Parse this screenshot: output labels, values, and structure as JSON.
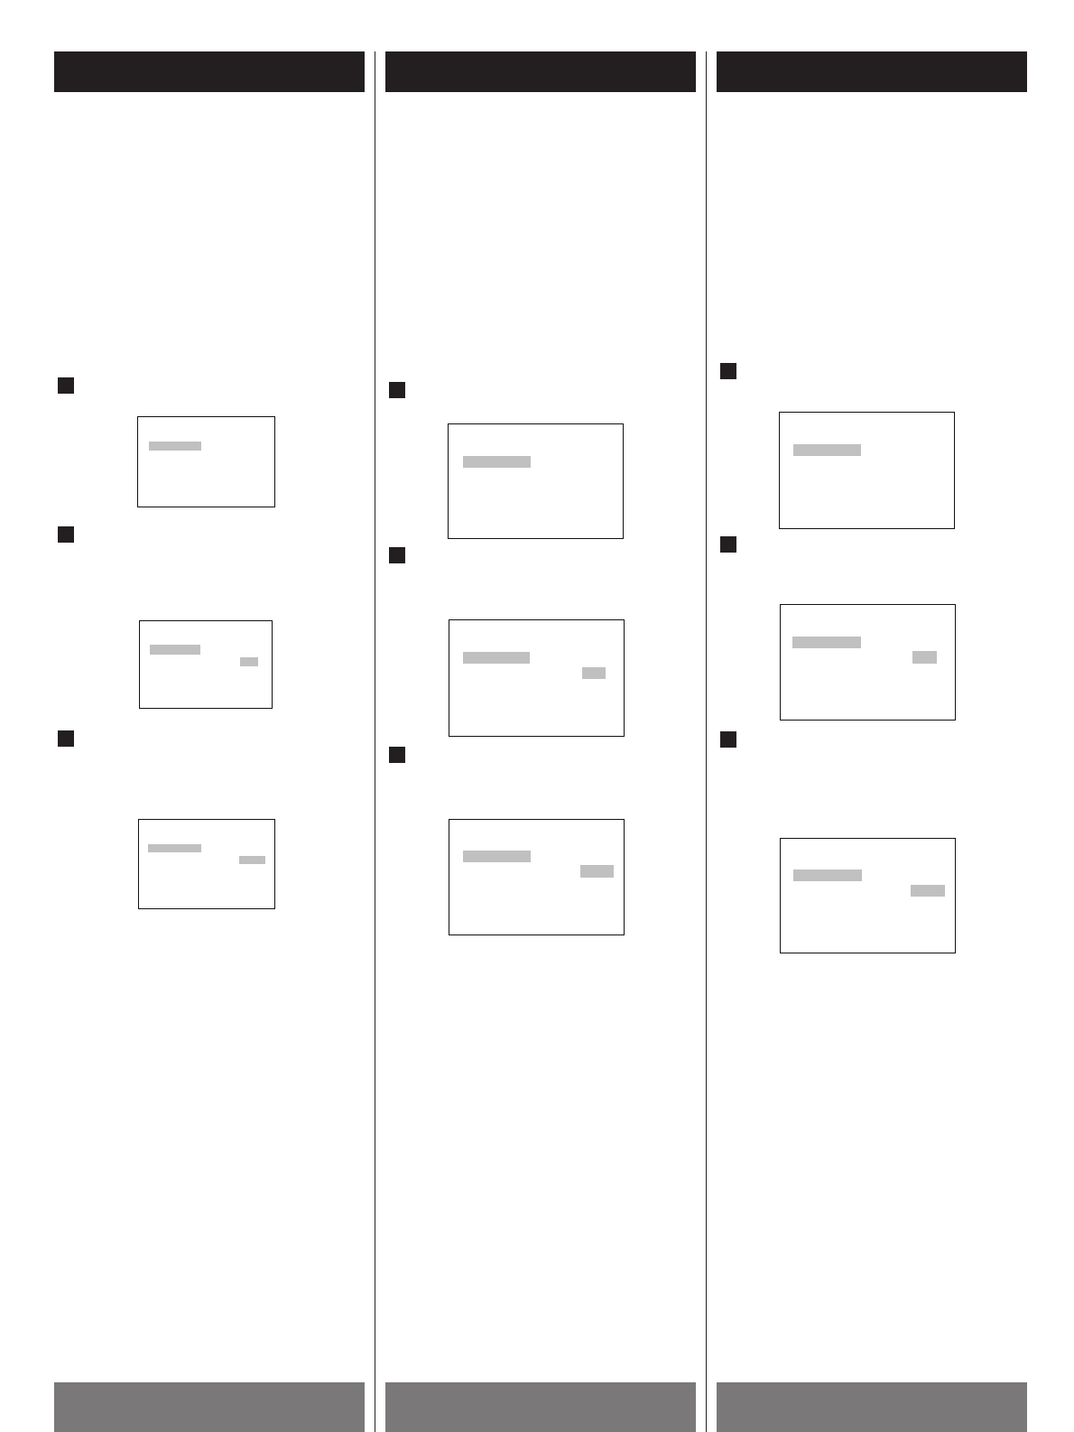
{
  "columns": [
    {
      "steps": [
        {
          "highlights": [
            {
              "kind": "item"
            }
          ]
        },
        {
          "highlights": [
            {
              "kind": "item"
            },
            {
              "kind": "value"
            }
          ]
        },
        {
          "highlights": [
            {
              "kind": "item"
            },
            {
              "kind": "value"
            }
          ]
        }
      ]
    },
    {
      "steps": [
        {
          "highlights": [
            {
              "kind": "item"
            }
          ]
        },
        {
          "highlights": [
            {
              "kind": "item"
            },
            {
              "kind": "value"
            }
          ]
        },
        {
          "highlights": [
            {
              "kind": "item"
            },
            {
              "kind": "value"
            }
          ]
        }
      ]
    },
    {
      "steps": [
        {
          "highlights": [
            {
              "kind": "item"
            }
          ]
        },
        {
          "highlights": [
            {
              "kind": "item"
            },
            {
              "kind": "value"
            }
          ]
        },
        {
          "highlights": [
            {
              "kind": "item"
            },
            {
              "kind": "value"
            }
          ]
        }
      ]
    }
  ]
}
